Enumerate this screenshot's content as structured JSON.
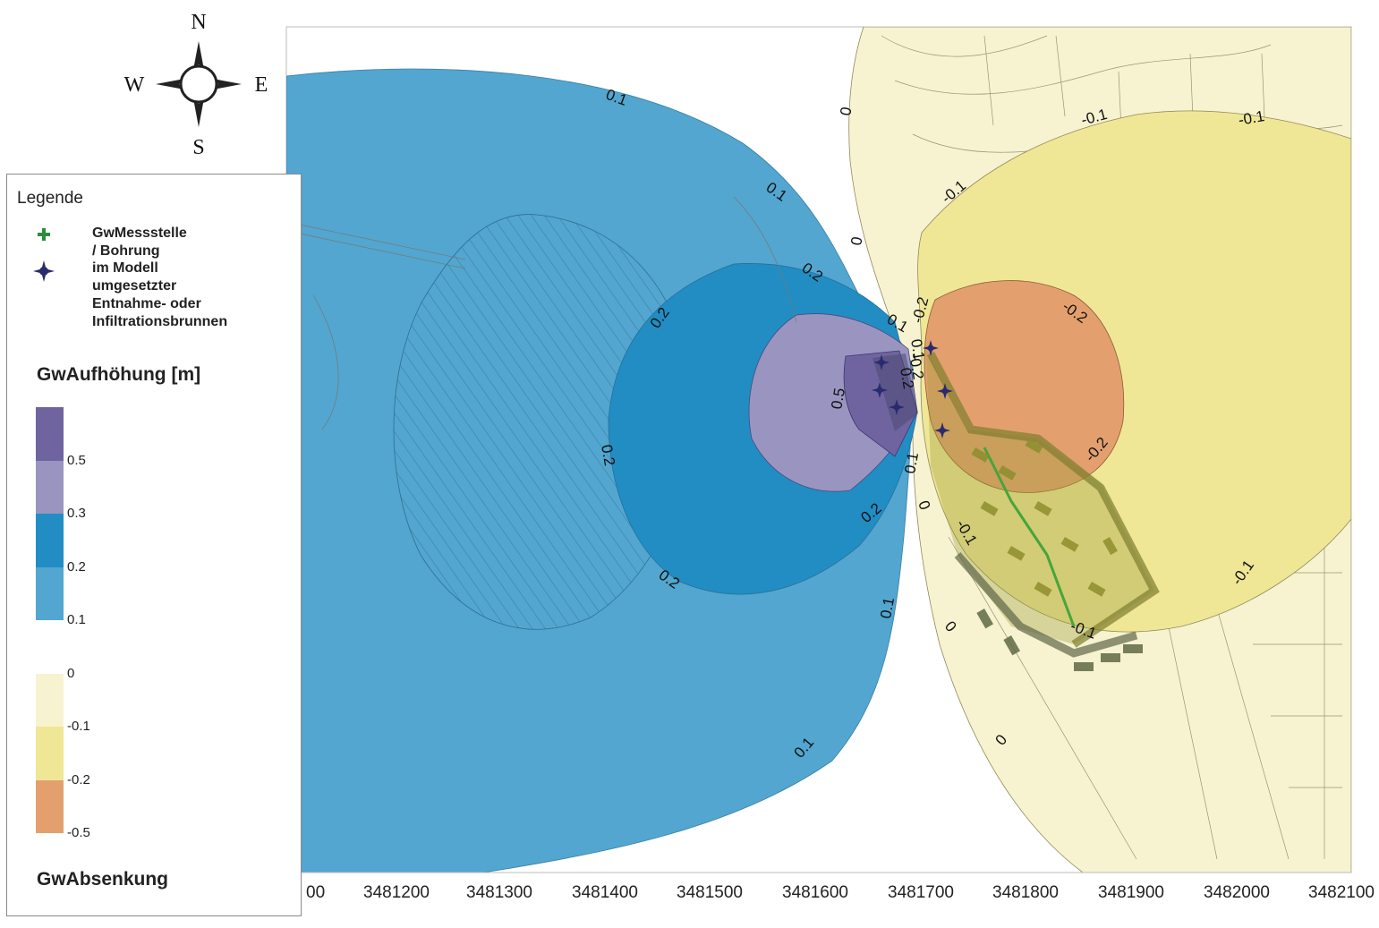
{
  "compass": {
    "north": "N",
    "east": "E",
    "south": "S",
    "west": "W"
  },
  "legend": {
    "title": "Legende",
    "items": [
      {
        "label": "GwMessstelle / Bohrung",
        "icon": "green-cross-icon"
      },
      {
        "label": "im Modell umgesetzter\nEntnahme- oder\nInfiltrationsbrunnen",
        "icon": "well-star-icon"
      }
    ],
    "rise_heading": "GwAufhöhung  [m]",
    "fall_heading": "GwAbsenkung",
    "scale": [
      {
        "label": "",
        "color": "#6f64a0"
      },
      {
        "label": "0.5",
        "color": "#9a95c0"
      },
      {
        "label": "0.3",
        "color": "#218dc3"
      },
      {
        "label": "0.2",
        "color": "#52a6cf"
      },
      {
        "label": "0.1",
        "color": "#ffffff"
      },
      {
        "label": "0",
        "color": "#f7f3d0"
      },
      {
        "label": "-0.1",
        "color": "#efe796"
      },
      {
        "label": "-0.2",
        "color": "#e3a06e"
      },
      {
        "label": "-0.5",
        "color": ""
      }
    ]
  },
  "x_axis": {
    "ticks": [
      "00",
      "3481200",
      "3481300",
      "3481400",
      "3481500",
      "3481600",
      "3481700",
      "3481800",
      "3481900",
      "3482000",
      "3482100"
    ]
  },
  "contour_labels": [
    {
      "text": "0.1"
    },
    {
      "text": "0.1"
    },
    {
      "text": "0.2"
    },
    {
      "text": "0.2"
    },
    {
      "text": "0.1"
    },
    {
      "text": "0.2"
    },
    {
      "text": "0.2"
    },
    {
      "text": "0.2"
    },
    {
      "text": "0.1"
    },
    {
      "text": "0.1"
    },
    {
      "text": "0.1"
    },
    {
      "text": "0.5"
    },
    {
      "text": "0"
    },
    {
      "text": "0"
    },
    {
      "text": "-0.1"
    },
    {
      "text": "-0.1"
    },
    {
      "text": "-0.1"
    },
    {
      "text": "-0.2"
    },
    {
      "text": "-0.2"
    },
    {
      "text": "-0.2"
    },
    {
      "text": "-0.1"
    },
    {
      "text": "-0.1"
    },
    {
      "text": "0"
    },
    {
      "text": "-0.1"
    },
    {
      "text": "0"
    },
    {
      "text": "0"
    },
    {
      "text": "-0.2"
    },
    {
      "text": "0.2"
    },
    {
      "text": "0.1"
    }
  ],
  "colors": {
    "rise_dark": "#6f64a0",
    "rise_lilac": "#9a95c0",
    "rise_blue": "#218dc3",
    "rise_light_blue": "#52a6cf",
    "fall_cream": "#f7f3d0",
    "fall_yellow": "#efe796",
    "fall_orange": "#e3a06e",
    "measuring_point": "#2e8b3e",
    "well": "#2a2a6e"
  }
}
